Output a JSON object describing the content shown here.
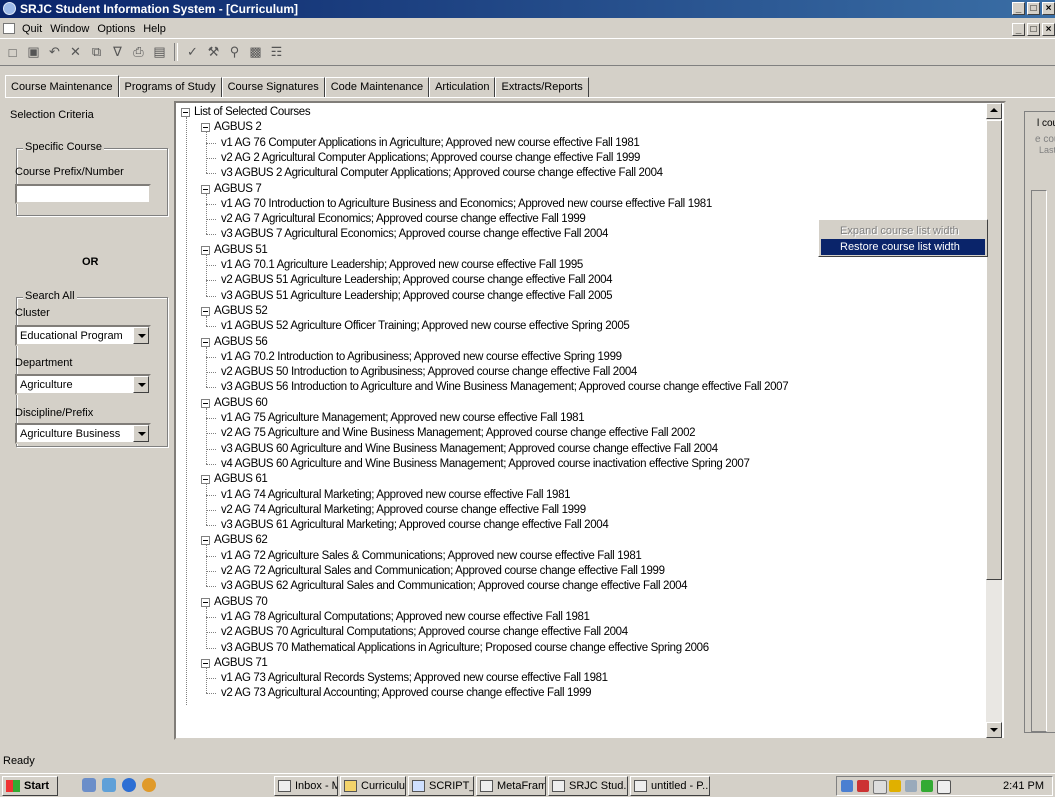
{
  "window": {
    "title": "SRJC Student Information System - [Curriculum]",
    "caption_buttons": [
      "_",
      "□",
      "×"
    ],
    "mdi_buttons": [
      "_",
      "□",
      "×"
    ]
  },
  "menu": {
    "items": [
      "Quit",
      "Window",
      "Options",
      "Help"
    ]
  },
  "toolbar": {
    "buttons": [
      "new-icon",
      "save-icon",
      "undo-icon",
      "delete-icon",
      "copy-icon",
      "filter-icon",
      "print-icon",
      "preview-icon",
      "spellcheck-icon",
      "tools-icon",
      "find-icon",
      "export-icon",
      "report-icon"
    ]
  },
  "tabs": [
    "Course Maintenance",
    "Programs of Study",
    "Course Signatures",
    "Code Maintenance",
    "Articulation",
    "Extracts/Reports"
  ],
  "left_panel": {
    "selection_criteria": "Selection Criteria",
    "specific_course_group": "Specific Course",
    "course_prefix_label": "Course Prefix/Number",
    "course_prefix_value": "",
    "or_label": "OR",
    "search_all_group": "Search All",
    "cluster_label": "Cluster",
    "cluster_value": "Educational Program",
    "department_label": "Department",
    "department_value": "Agriculture",
    "discipline_label": "Discipline/Prefix",
    "discipline_value": "Agriculture Business"
  },
  "tree": {
    "root": "List of Selected Courses",
    "groups": [
      {
        "name": "AGBUS 2",
        "versions": [
          "v1  AG 76 Computer Applications in Agriculture; Approved new course effective Fall 1981",
          "v2  AG 2 Agricultural Computer Applications; Approved course change effective Fall 1999",
          "v3  AGBUS 2 Agricultural Computer Applications; Approved course change effective Fall 2004"
        ]
      },
      {
        "name": "AGBUS 7",
        "versions": [
          "v1  AG 70 Introduction to Agriculture Business and Economics; Approved new course effective Fall 1981",
          "v2  AG 7 Agricultural Economics; Approved course change effective Fall 1999",
          "v3  AGBUS 7 Agricultural Economics; Approved course change effective Fall 2004"
        ]
      },
      {
        "name": "AGBUS 51",
        "versions": [
          "v1  AG 70.1 Agriculture Leadership; Approved new course effective Fall 1995",
          "v2  AGBUS 51 Agriculture Leadership; Approved course change effective Fall 2004",
          "v3  AGBUS 51 Agriculture Leadership; Approved course change effective Fall 2005"
        ]
      },
      {
        "name": "AGBUS 52",
        "versions": [
          "v1  AGBUS 52 Agriculture Officer Training; Approved new course effective Spring 2005"
        ]
      },
      {
        "name": "AGBUS 56",
        "versions": [
          "v1  AG 70.2 Introduction to Agribusiness; Approved new course effective Spring 1999",
          "v2  AGBUS 50 Introduction to Agribusiness; Approved course change effective Fall 2004",
          "v3  AGBUS 56 Introduction to Agriculture and Wine Business Management; Approved course change effective Fall 2007"
        ]
      },
      {
        "name": "AGBUS 60",
        "versions": [
          "v1  AG 75 Agriculture Management; Approved new course effective Fall 1981",
          "v2  AG 75 Agriculture and Wine Business Management; Approved course change effective Fall 2002",
          "v3  AGBUS 60 Agriculture and Wine Business Management; Approved course change effective Fall 2004",
          "v4  AGBUS 60 Agriculture and Wine Business Management; Approved course inactivation effective Spring 2007"
        ]
      },
      {
        "name": "AGBUS 61",
        "versions": [
          "v1  AG 74 Agricultural Marketing; Approved new course effective Fall 1981",
          "v2  AG 74 Agricultural Marketing; Approved course change effective Fall 1999",
          "v3  AGBUS 61 Agricultural Marketing; Approved course change effective Fall 2004"
        ]
      },
      {
        "name": "AGBUS 62",
        "versions": [
          "v1  AG 72 Agriculture Sales & Communications; Approved new course effective Fall 1981",
          "v2  AG 72 Agricultural Sales and Communication; Approved course change effective Fall 1999",
          "v3  AGBUS 62 Agricultural Sales and Communication; Approved course change effective Fall 2004"
        ]
      },
      {
        "name": "AGBUS 70",
        "versions": [
          "v1  AG 78 Agricultural Computations; Approved new course effective Fall 1981",
          "v2  AGBUS 70 Agricultural Computations; Approved course change effective Fall 2004",
          "v3  AGBUS 70 Mathematical Applications in Agriculture; Proposed course change effective Spring 2006"
        ]
      },
      {
        "name": "AGBUS 71",
        "versions": [
          "v1  AG 73 Agricultural Records Systems; Approved new course effective Fall 1981",
          "v2  AG 73 Agricultural Accounting; Approved course change effective Fall 1999"
        ]
      }
    ]
  },
  "context_menu": {
    "items": [
      {
        "label": "Expand course list width",
        "state": "disabled"
      },
      {
        "label": "Restore course list width",
        "state": "highlighted"
      }
    ]
  },
  "right_panel": {
    "texts": [
      "l cour",
      "e cou",
      "Last"
    ]
  },
  "status": {
    "text": "Ready"
  },
  "taskbar": {
    "start_label": "Start",
    "tasks": [
      "Inbox - Mic...",
      "Curriculum ...",
      "SCRIPT_C...",
      "MetaFram...",
      "SRJC Stud...",
      "untitled - P..."
    ],
    "clock": "2:41 PM"
  },
  "colors": {
    "title_bar": "#0a246a",
    "highlight": "#0a246a",
    "face": "#d4d0c8"
  }
}
